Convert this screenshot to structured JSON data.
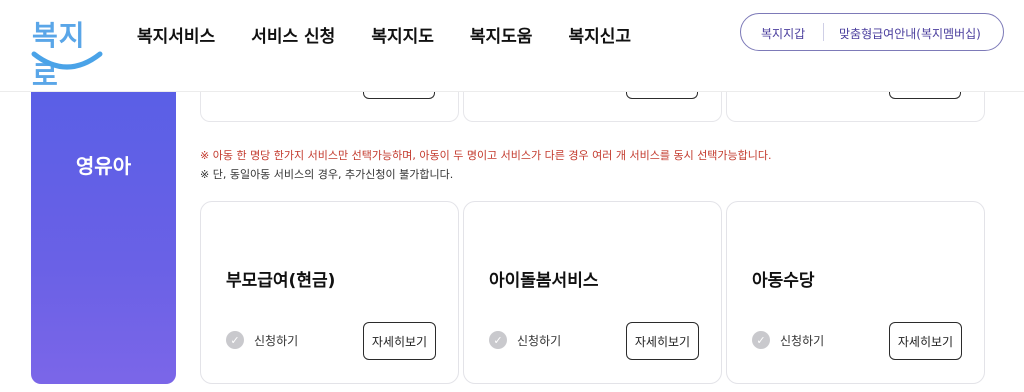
{
  "logo": {
    "text": "복지로"
  },
  "nav": [
    "복지서비스",
    "서비스 신청",
    "복지지도",
    "복지도움",
    "복지신고"
  ],
  "pill": {
    "left_label": "복지지갑",
    "right_label": "맞춤형급여안내(복지멤버십)"
  },
  "sidebar": {
    "label": "영유아"
  },
  "notices": [
    "※ 아동 한 명당 한가지 서비스만 선택가능하며, 아동이 두 명이고 서비스가 다른 경우 여러 개 서비스를 동시 선택가능합니다.",
    "※ 단, 동일아동 서비스의 경우, 추가신청이 불가합니다."
  ],
  "cards": [
    {
      "title": "부모급여(현금)",
      "apply_label": "신청하기",
      "detail_label": "자세히보기"
    },
    {
      "title": "아이돌봄서비스",
      "apply_label": "신청하기",
      "detail_label": "자세히보기"
    },
    {
      "title": "아동수당",
      "apply_label": "신청하기",
      "detail_label": "자세히보기"
    }
  ],
  "colors": {
    "sidebar_start": "#5a5fe6",
    "sidebar_end": "#7b66e8",
    "notice_red": "#c33a2d",
    "pill_border": "#7d7ab8"
  },
  "icons": {
    "apply": "check-circle-icon",
    "logo": "smile-logo-icon"
  }
}
